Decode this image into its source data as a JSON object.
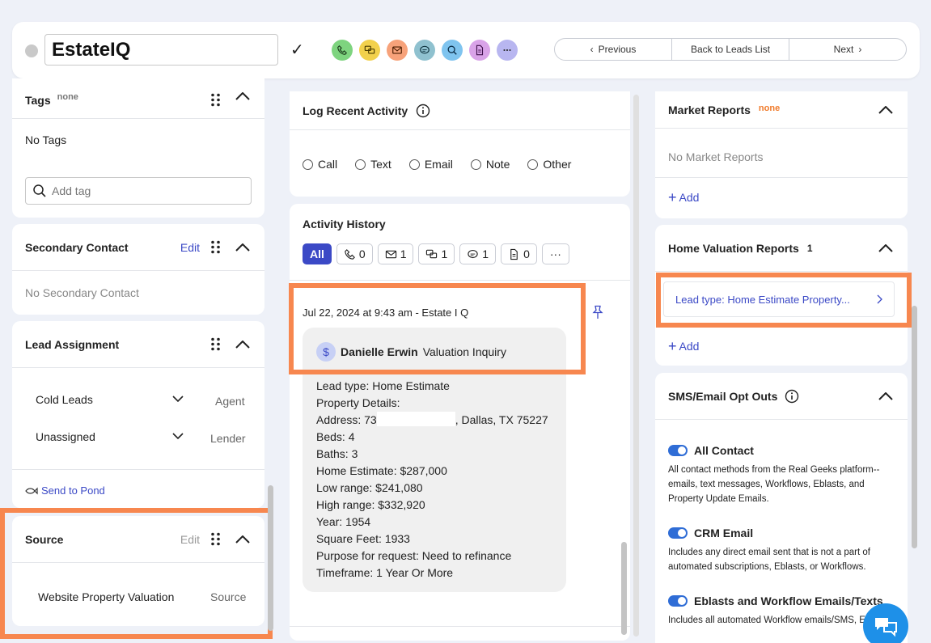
{
  "header": {
    "lead_name": "EstateIQ",
    "nav": {
      "previous": "Previous",
      "back": "Back to Leads List",
      "next": "Next"
    },
    "action_icons": [
      {
        "name": "phone-icon",
        "color": "#7ed47f"
      },
      {
        "name": "chat-icon",
        "color": "#f2d14c"
      },
      {
        "name": "email-icon",
        "color": "#f7a27a"
      },
      {
        "name": "message-icon",
        "color": "#8fc1cf"
      },
      {
        "name": "search-icon",
        "color": "#7fc4ef"
      },
      {
        "name": "document-icon",
        "color": "#d9a3e8"
      },
      {
        "name": "more-icon",
        "color": "#b8b6f0"
      }
    ]
  },
  "left": {
    "tags": {
      "title": "Tags",
      "badge": "none",
      "empty": "No Tags",
      "placeholder": "Add tag"
    },
    "secondary": {
      "title": "Secondary Contact",
      "edit": "Edit",
      "empty": "No Secondary Contact"
    },
    "assignment": {
      "title": "Lead Assignment",
      "rows": [
        {
          "value": "Cold Leads",
          "role": "Agent"
        },
        {
          "value": "Unassigned",
          "role": "Lender"
        }
      ],
      "pond": "Send to Pond"
    },
    "source": {
      "title": "Source",
      "edit": "Edit",
      "value": "Website Property Valuation",
      "label": "Source"
    }
  },
  "middle": {
    "log": {
      "title": "Log Recent Activity",
      "options": [
        "Call",
        "Text",
        "Email",
        "Note",
        "Other"
      ]
    },
    "history": {
      "title": "Activity History",
      "tabs": {
        "all": "All",
        "calls": "0",
        "emails": "1",
        "texts": "1",
        "messages": "1",
        "notes": "0",
        "more": "···"
      },
      "entry": {
        "timestamp": "Jul 22, 2024 at 9:43 am - Estate I Q",
        "person": "Danielle Erwin",
        "type": "Valuation Inquiry",
        "lines": [
          "Lead type: Home Estimate",
          "Property Details:",
          "Address: 73",
          "Beds: 4",
          "Baths: 3",
          "Home Estimate: $287,000",
          "Low range: $241,080",
          "High range: $332,920",
          "Year: 1954",
          "Square Feet: 1933",
          "Purpose for request: Need to refinance",
          "Timeframe: 1 Year Or More"
        ],
        "address_suffix": ", Dallas, TX 75227"
      }
    }
  },
  "right": {
    "market": {
      "title": "Market Reports",
      "badge": "none",
      "empty": "No Market Reports",
      "add": "Add"
    },
    "valuation": {
      "title": "Home Valuation Reports",
      "count": "1",
      "item": "Lead type: Home Estimate Property...",
      "add": "Add"
    },
    "optouts": {
      "title": "SMS/Email Opt Outs",
      "items": [
        {
          "title": "All Contact",
          "desc": "All contact methods from the Real Geeks platform--emails, text messages, Workflows, Eblasts, and Property Update Emails."
        },
        {
          "title": "CRM Email",
          "desc": "Includes any direct email sent that is not a part of automated subscriptions, Eblasts, or Workflows."
        },
        {
          "title": "Eblasts and Workflow Emails/Texts",
          "desc": "Includes all automated Workflow emails/SMS, Eblasts."
        }
      ]
    }
  },
  "colors": {
    "accent": "#3b49c6",
    "highlight": "#f7874f",
    "toggle": "#2f6dd6",
    "badge_orange": "#f07a2a"
  }
}
